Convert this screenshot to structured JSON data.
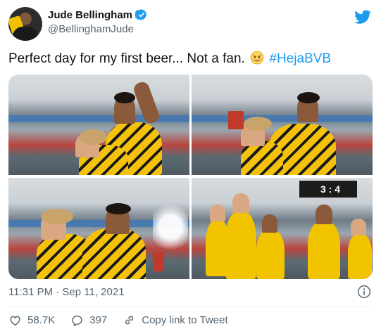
{
  "author": {
    "display_name": "Jude Bellingham",
    "handle": "@BellinghamJude",
    "verified_icon": "verified-badge-icon",
    "avatar": "profile-photo"
  },
  "brand_icon": "twitter-bird-icon",
  "colors": {
    "brand": "#1d9bf0",
    "text": "#0f1419",
    "secondary": "#536471",
    "divider": "#eff3f4"
  },
  "tweet": {
    "text": "Perfect day for my first beer... Not a fan.",
    "emoji": "woozy-face-emoji",
    "hashtag": "#HejaBVB"
  },
  "media": {
    "photos": [
      "photo-1",
      "photo-2",
      "photo-3",
      "photo-4"
    ],
    "scoreboard": "3 : 4"
  },
  "meta": {
    "timestamp": "11:31 PM · Sep 11, 2021"
  },
  "actions": {
    "likes": "58.7K",
    "replies": "397",
    "copy_link_label": "Copy link to Tweet"
  }
}
